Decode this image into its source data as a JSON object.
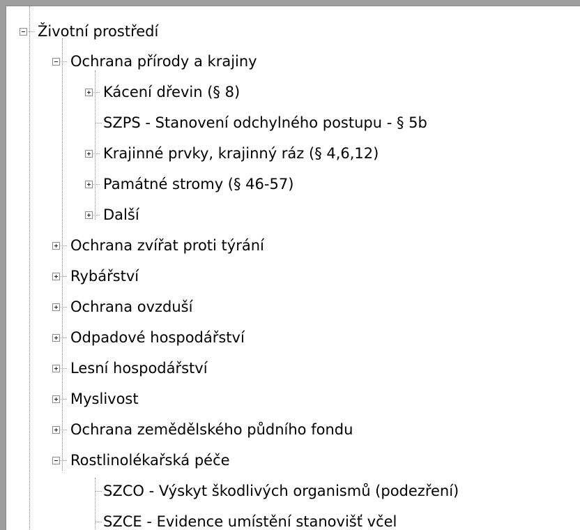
{
  "tree": {
    "root": {
      "label": "Životní prostředí",
      "state": "expanded"
    },
    "level1": [
      {
        "label": "Ochrana přírody a krajiny",
        "state": "expanded",
        "children": [
          {
            "label": "Kácení dřevin (§ 8)",
            "state": "collapsed"
          },
          {
            "label": "SZPS - Stanovení odchylného postupu - § 5b",
            "state": "leaf"
          },
          {
            "label": "Krajinné prvky, krajinný ráz (§ 4,6,12)",
            "state": "collapsed"
          },
          {
            "label": "Památné stromy (§ 46-57)",
            "state": "collapsed"
          },
          {
            "label": "Další",
            "state": "collapsed"
          }
        ]
      },
      {
        "label": "Ochrana zvířat proti týrání",
        "state": "collapsed"
      },
      {
        "label": "Rybářství",
        "state": "collapsed"
      },
      {
        "label": "Ochrana ovzduší",
        "state": "collapsed"
      },
      {
        "label": "Odpadové hospodářství",
        "state": "collapsed"
      },
      {
        "label": "Lesní hospodářství",
        "state": "collapsed"
      },
      {
        "label": "Myslivost",
        "state": "collapsed"
      },
      {
        "label": "Ochrana zemědělského půdního fondu",
        "state": "collapsed"
      },
      {
        "label": "Rostlinolékařská péče",
        "state": "expanded",
        "children": [
          {
            "label": "SZCO - Výskyt škodlivých organismů (podezření)",
            "state": "leaf"
          },
          {
            "label": "SZCE - Evidence umístění stanovišť včel",
            "state": "leaf"
          }
        ]
      }
    ]
  }
}
